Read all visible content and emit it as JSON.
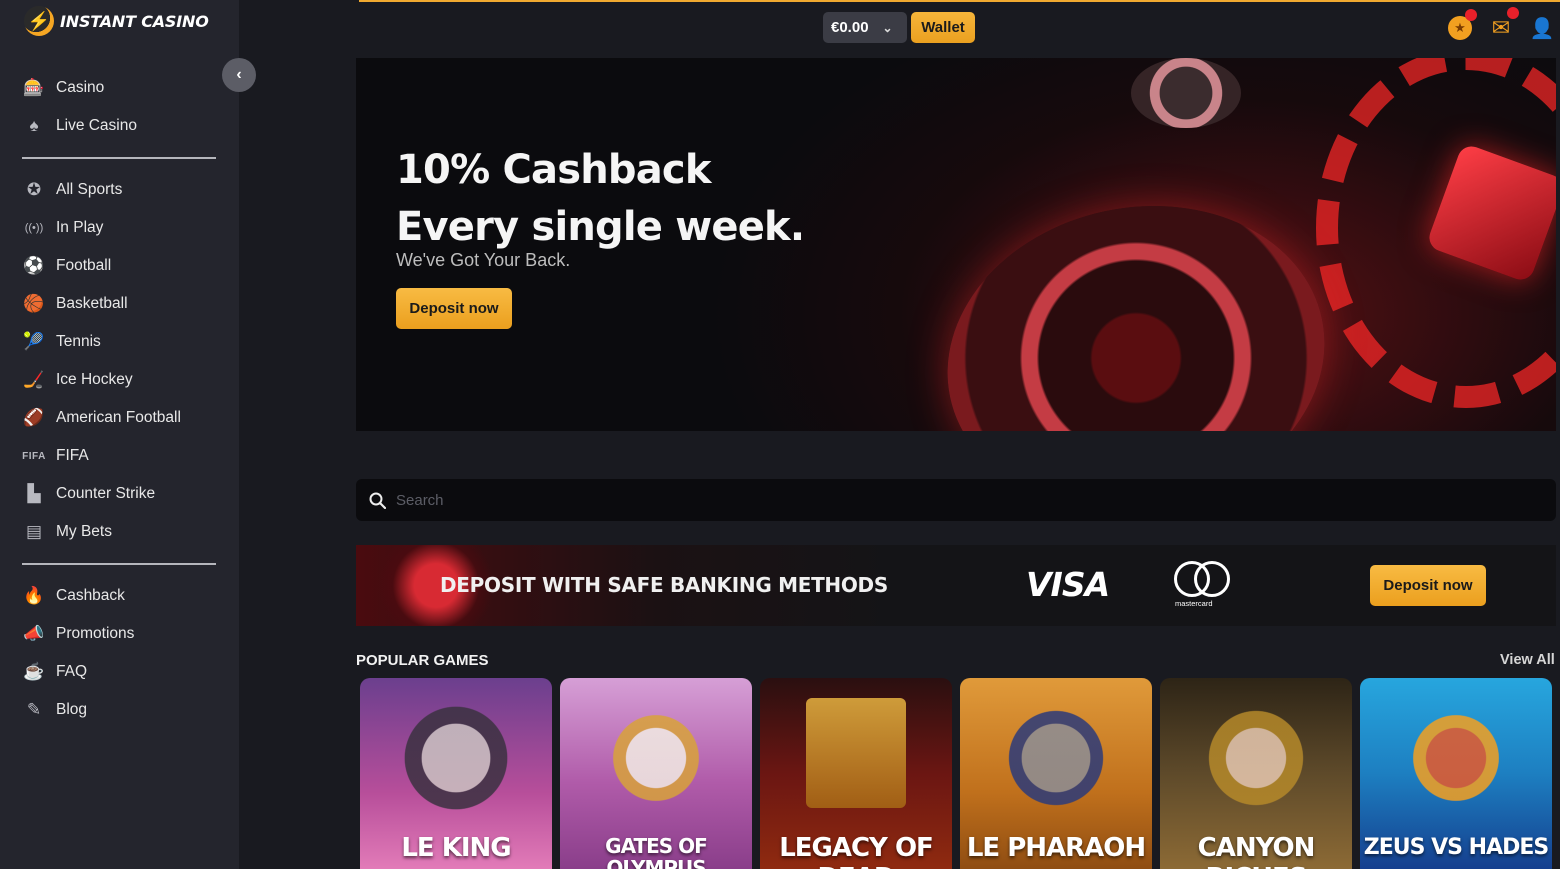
{
  "brand": {
    "name": "INSTANT CASINO",
    "logo_glyph": "⚡"
  },
  "sidebar": {
    "collapse_icon": "‹",
    "group1": [
      {
        "label": "Casino",
        "icon": "casino-icon",
        "glyph": "🎰"
      },
      {
        "label": "Live Casino",
        "icon": "live-casino-icon",
        "glyph": "♠"
      }
    ],
    "group2": [
      {
        "label": "All Sports",
        "icon": "all-sports-icon",
        "glyph": "✪"
      },
      {
        "label": "In Play",
        "icon": "in-play-icon",
        "glyph": "((•))"
      },
      {
        "label": "Football",
        "icon": "football-icon",
        "glyph": "⚽"
      },
      {
        "label": "Basketball",
        "icon": "basketball-icon",
        "glyph": "🏀"
      },
      {
        "label": "Tennis",
        "icon": "tennis-icon",
        "glyph": "🎾"
      },
      {
        "label": "Ice Hockey",
        "icon": "ice-hockey-icon",
        "glyph": "🏒"
      },
      {
        "label": "American Football",
        "icon": "american-football-icon",
        "glyph": "🏈"
      },
      {
        "label": "FIFA",
        "icon": "fifa-icon",
        "glyph": "FIFA"
      },
      {
        "label": "Counter Strike",
        "icon": "counter-strike-icon",
        "glyph": "▙"
      },
      {
        "label": "My Bets",
        "icon": "my-bets-icon",
        "glyph": "▤"
      }
    ],
    "group3": [
      {
        "label": "Cashback",
        "icon": "cashback-icon",
        "glyph": "🔥"
      },
      {
        "label": "Promotions",
        "icon": "promotions-icon",
        "glyph": "📣"
      },
      {
        "label": "FAQ",
        "icon": "faq-icon",
        "glyph": "☕"
      },
      {
        "label": "Blog",
        "icon": "blog-icon",
        "glyph": "✎"
      }
    ]
  },
  "header": {
    "balance": "€0.00",
    "balance_chevron": "⌄",
    "wallet_label": "Wallet",
    "coin_glyph": "★",
    "mail_glyph": "✉",
    "user_glyph": "👤"
  },
  "hero": {
    "title_line1": "10% Cashback",
    "title_line2": "Every single week.",
    "subtitle": "We've Got Your Back.",
    "button_label": "Deposit now"
  },
  "search": {
    "placeholder": "Search",
    "icon_glyph": "🔍"
  },
  "banking": {
    "text": "DEPOSIT WITH SAFE BANKING METHODS",
    "visa_label": "VISA",
    "mastercard_label": "mastercard",
    "button_label": "Deposit now"
  },
  "popular": {
    "title": "POPULAR GAMES",
    "view_all": "View All",
    "games": [
      {
        "title": "LE KING"
      },
      {
        "title": "GATES OF OLYMPUS"
      },
      {
        "title": "LEGACY OF DEAD"
      },
      {
        "title": "LE PHARAOH"
      },
      {
        "title": "CANYON RICHES"
      },
      {
        "title": "ZEUS VS HADES"
      }
    ]
  },
  "colors": {
    "accent": "#f0a930",
    "background": "#191a20",
    "sidebar": "#24252d",
    "notification": "#e8202a"
  }
}
